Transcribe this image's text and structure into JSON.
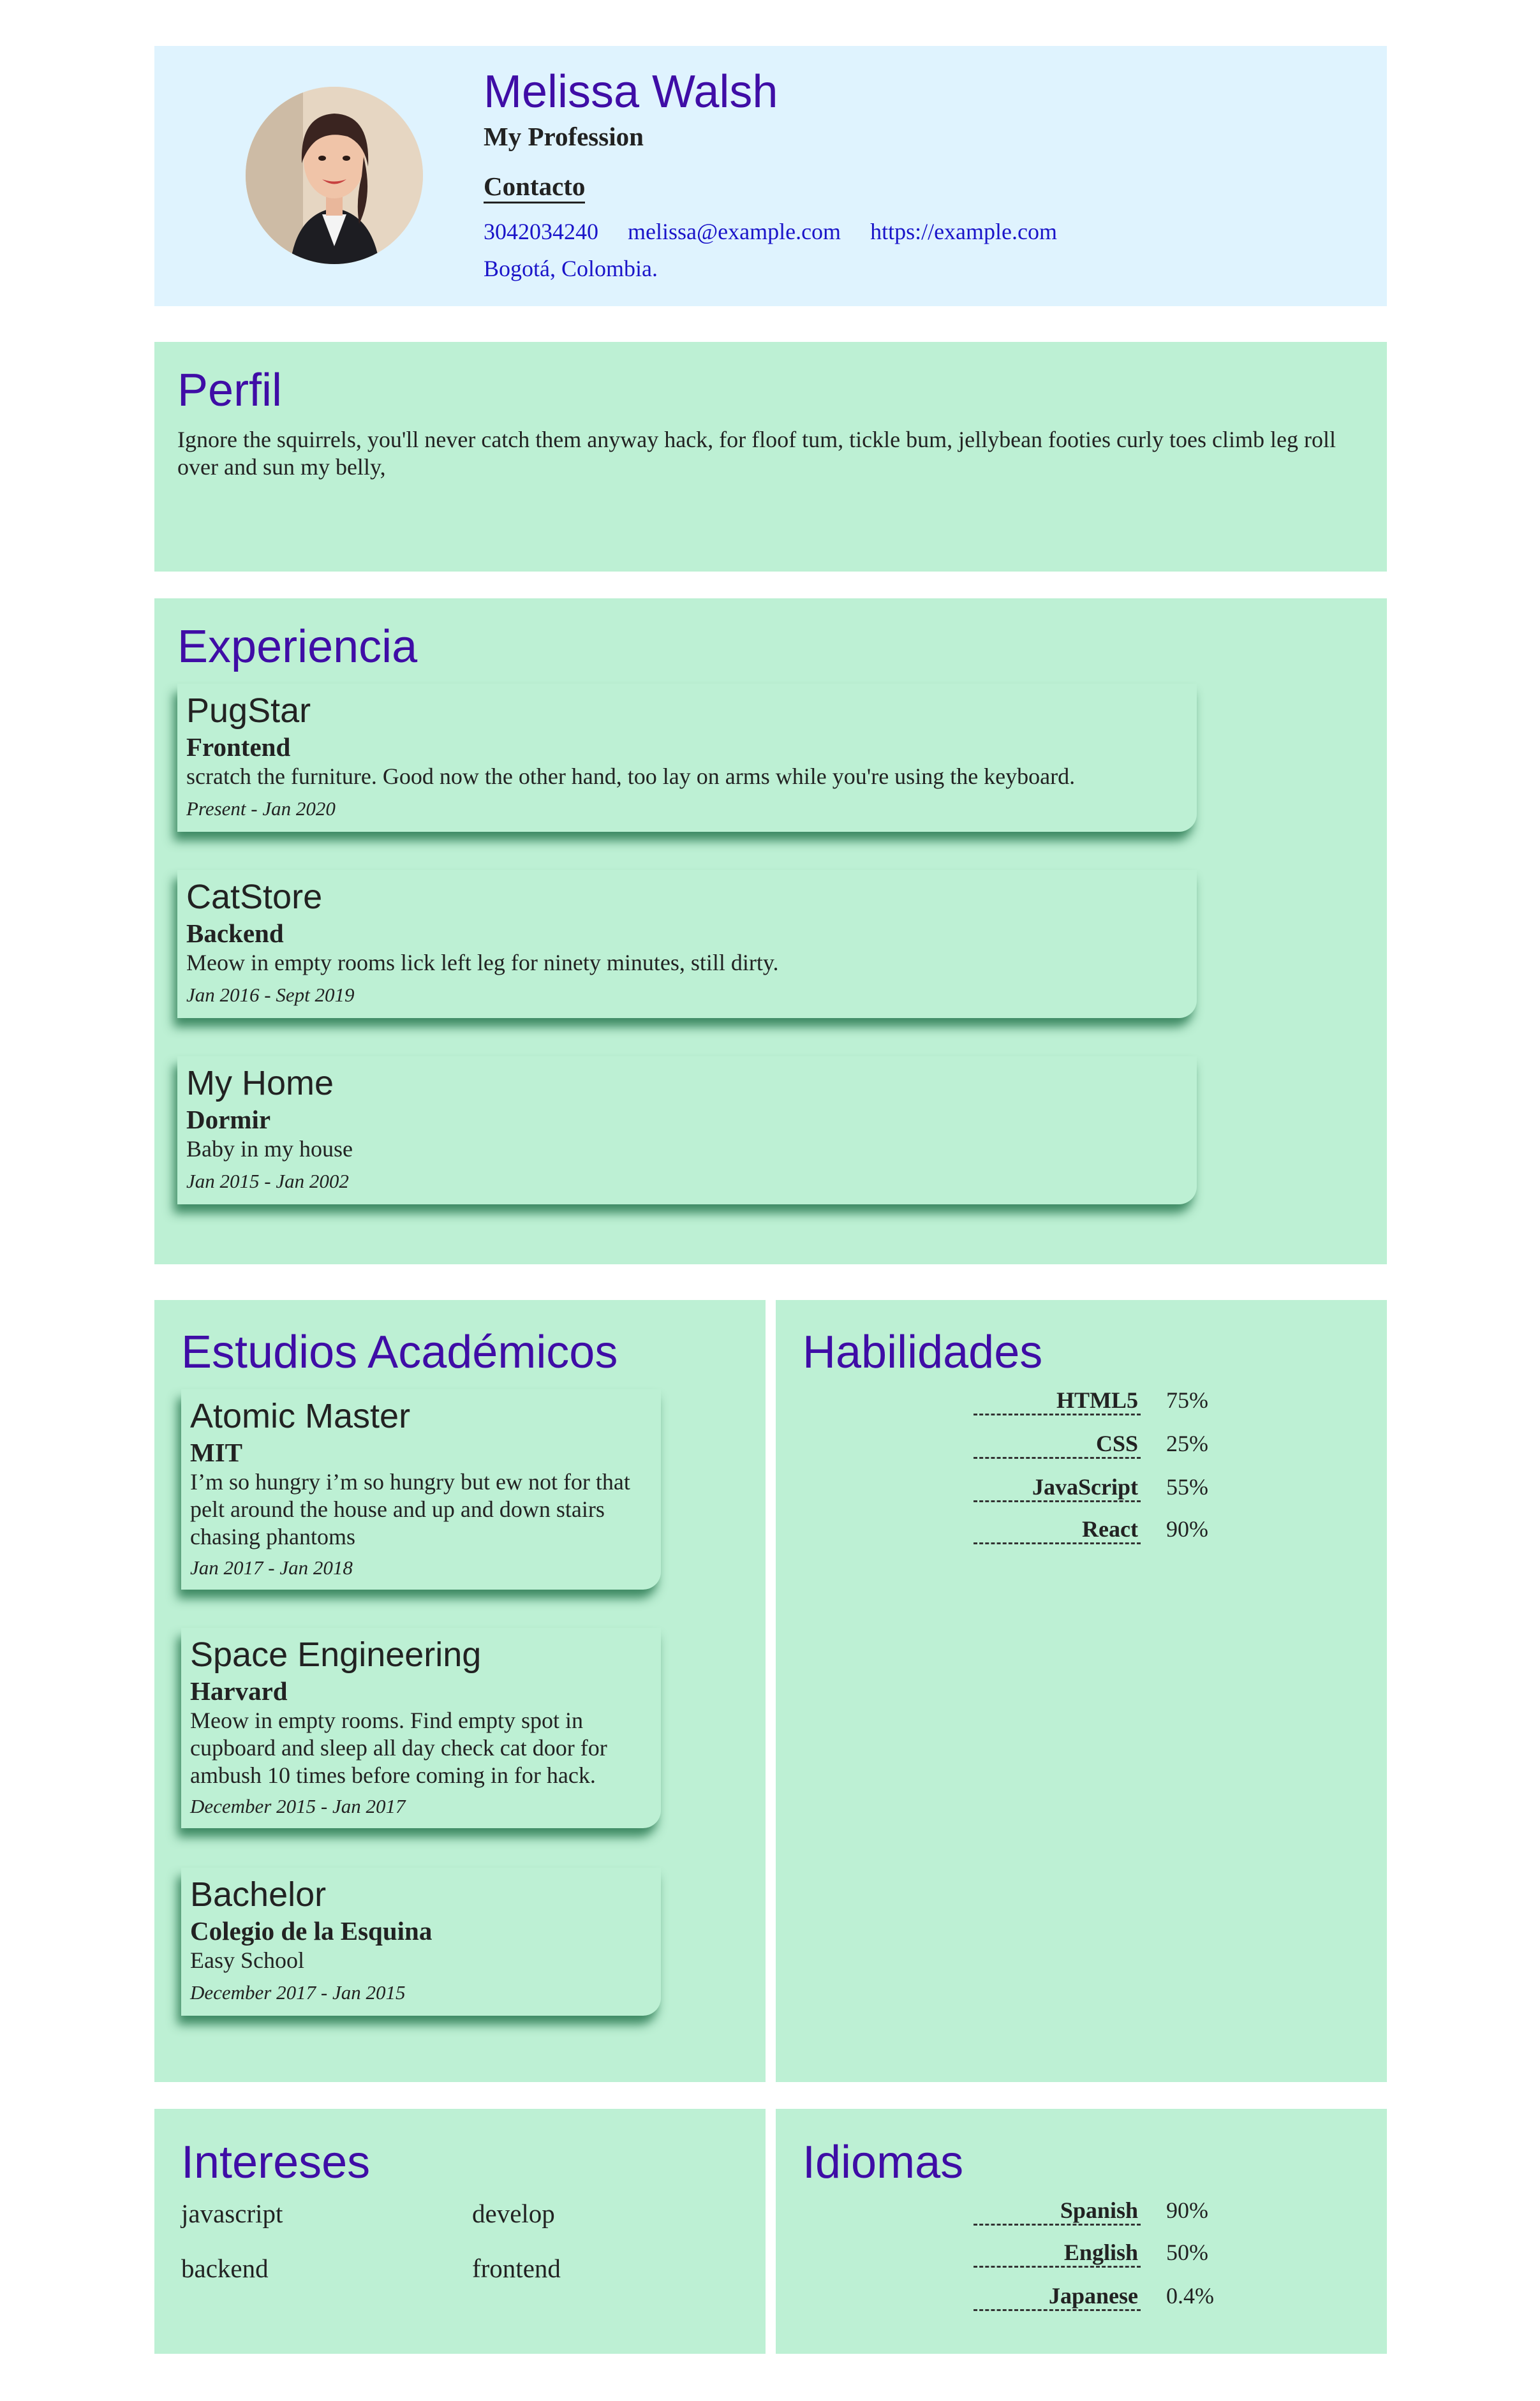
{
  "header": {
    "name": "Melissa Walsh",
    "profession": "My Profession",
    "contact_title": "Contacto",
    "phone": "3042034240",
    "email": "melissa@example.com",
    "website": "https://example.com",
    "location": "Bogotá, Colombia."
  },
  "profile": {
    "title": "Perfil",
    "text": "Ignore the squirrels, you'll never catch them anyway hack, for floof tum, tickle bum, jellybean footies curly toes climb leg roll over and sun my belly,"
  },
  "experience": {
    "title": "Experiencia",
    "items": [
      {
        "company": "PugStar",
        "role": "Frontend",
        "description": "scratch the furniture. Good now the other hand, too lay on arms while you're using the keyboard.",
        "dates": "Present - Jan 2020"
      },
      {
        "company": "CatStore",
        "role": "Backend",
        "description": "Meow in empty rooms lick left leg for ninety minutes, still dirty.",
        "dates": "Jan 2016 - Sept 2019"
      },
      {
        "company": "My Home",
        "role": "Dormir",
        "description": "Baby in my house",
        "dates": "Jan 2015 - Jan 2002"
      }
    ]
  },
  "education": {
    "title": "Estudios Académicos",
    "items": [
      {
        "degree": "Atomic Master",
        "school": "MIT",
        "description": "I’m so hungry i’m so hungry but ew not for that pelt around the house and up and down stairs chasing phantoms",
        "dates": "Jan 2017 - Jan 2018"
      },
      {
        "degree": "Space Engineering",
        "school": "Harvard",
        "description": "Meow in empty rooms. Find empty spot in cupboard and sleep all day check cat door for ambush 10 times before coming in for hack.",
        "dates": "December 2015 - Jan 2017"
      },
      {
        "degree": "Bachelor",
        "school": "Colegio de la Esquina",
        "description": "Easy School",
        "dates": "December 2017 - Jan 2015"
      }
    ]
  },
  "skills": {
    "title": "Habilidades",
    "items": [
      {
        "name": "HTML5",
        "value": "75%"
      },
      {
        "name": "CSS",
        "value": "25%"
      },
      {
        "name": "JavaScript",
        "value": "55%"
      },
      {
        "name": "React",
        "value": "90%"
      }
    ]
  },
  "interests": {
    "title": "Intereses",
    "items": [
      "javascript",
      "develop",
      "backend",
      "frontend"
    ]
  },
  "languages": {
    "title": "Idiomas",
    "items": [
      {
        "name": "Spanish",
        "value": "90%"
      },
      {
        "name": "English",
        "value": "50%"
      },
      {
        "name": "Japanese",
        "value": "0.4%"
      }
    ]
  },
  "colors": {
    "header_bg": "#dff3fe",
    "section_bg": "#bdf0d4",
    "heading": "#3f0da6",
    "link": "#1a14c9"
  }
}
